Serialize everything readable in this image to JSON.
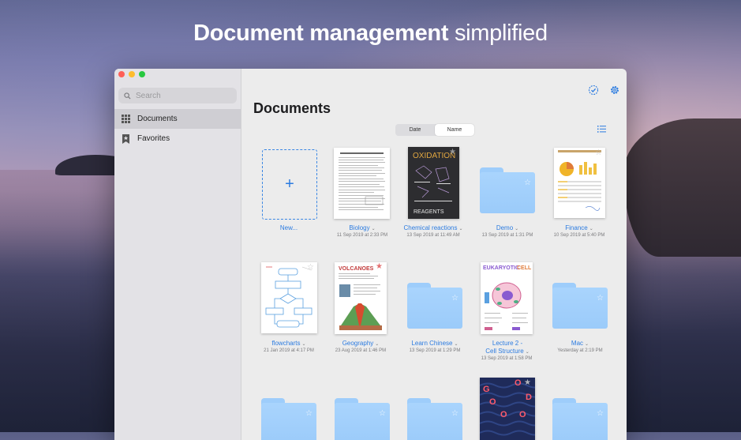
{
  "headline": {
    "strong": "Document management",
    "light": "simplified"
  },
  "sidebar": {
    "search_placeholder": "Search",
    "items": [
      {
        "label": "Documents",
        "icon": "grid-icon",
        "active": true
      },
      {
        "label": "Favorites",
        "icon": "bookmark-star-icon",
        "active": false
      }
    ]
  },
  "main": {
    "title": "Documents",
    "sort": {
      "options": [
        "Date",
        "Name"
      ],
      "selected": "Name"
    },
    "toolbar_icons": [
      "select-check-icon",
      "settings-gear-icon",
      "list-view-icon"
    ],
    "new_label": "New...",
    "items": [
      {
        "name": "Biology",
        "date": "11 Sep 2019 at 2:33 PM",
        "kind": "document"
      },
      {
        "name": "Chemical reactions",
        "date": "13 Sep 2019 at 11:49 AM",
        "kind": "document"
      },
      {
        "name": "Demo",
        "date": "13 Sep 2019 at 1:31 PM",
        "kind": "folder"
      },
      {
        "name": "Finance",
        "date": "10 Sep 2019 at 5:40 PM",
        "kind": "document"
      },
      {
        "name": "flowcharts",
        "date": "21 Jan 2019 at 4:17 PM",
        "kind": "document"
      },
      {
        "name": "Geography",
        "date": "23 Aug 2019 at 1:46 PM",
        "kind": "document"
      },
      {
        "name": "Learn Chinese",
        "date": "13 Sep 2019 at 1:29 PM",
        "kind": "folder"
      },
      {
        "name": "Lecture 2 -",
        "name2": "Cell Structure",
        "date": "13 Sep 2019 at 1:58 PM",
        "kind": "document"
      },
      {
        "name": "Mac",
        "date": "Yesterday at 2:19 PM",
        "kind": "folder"
      }
    ],
    "thumb_text": {
      "oxidation": "OXIDATION",
      "reagents": "REAGENTS",
      "volcanoes": "VOLCANOES",
      "eukaryotic": "EUKARYOTIC",
      "cell": "CELL",
      "go": [
        "G",
        "O",
        "O",
        "D",
        "O",
        "O"
      ]
    }
  },
  "colors": {
    "accent": "#2b7be0",
    "folder": "#9fcdfb",
    "traffic_red": "#fe5f57",
    "traffic_yellow": "#febc2e",
    "traffic_green": "#28c840"
  }
}
